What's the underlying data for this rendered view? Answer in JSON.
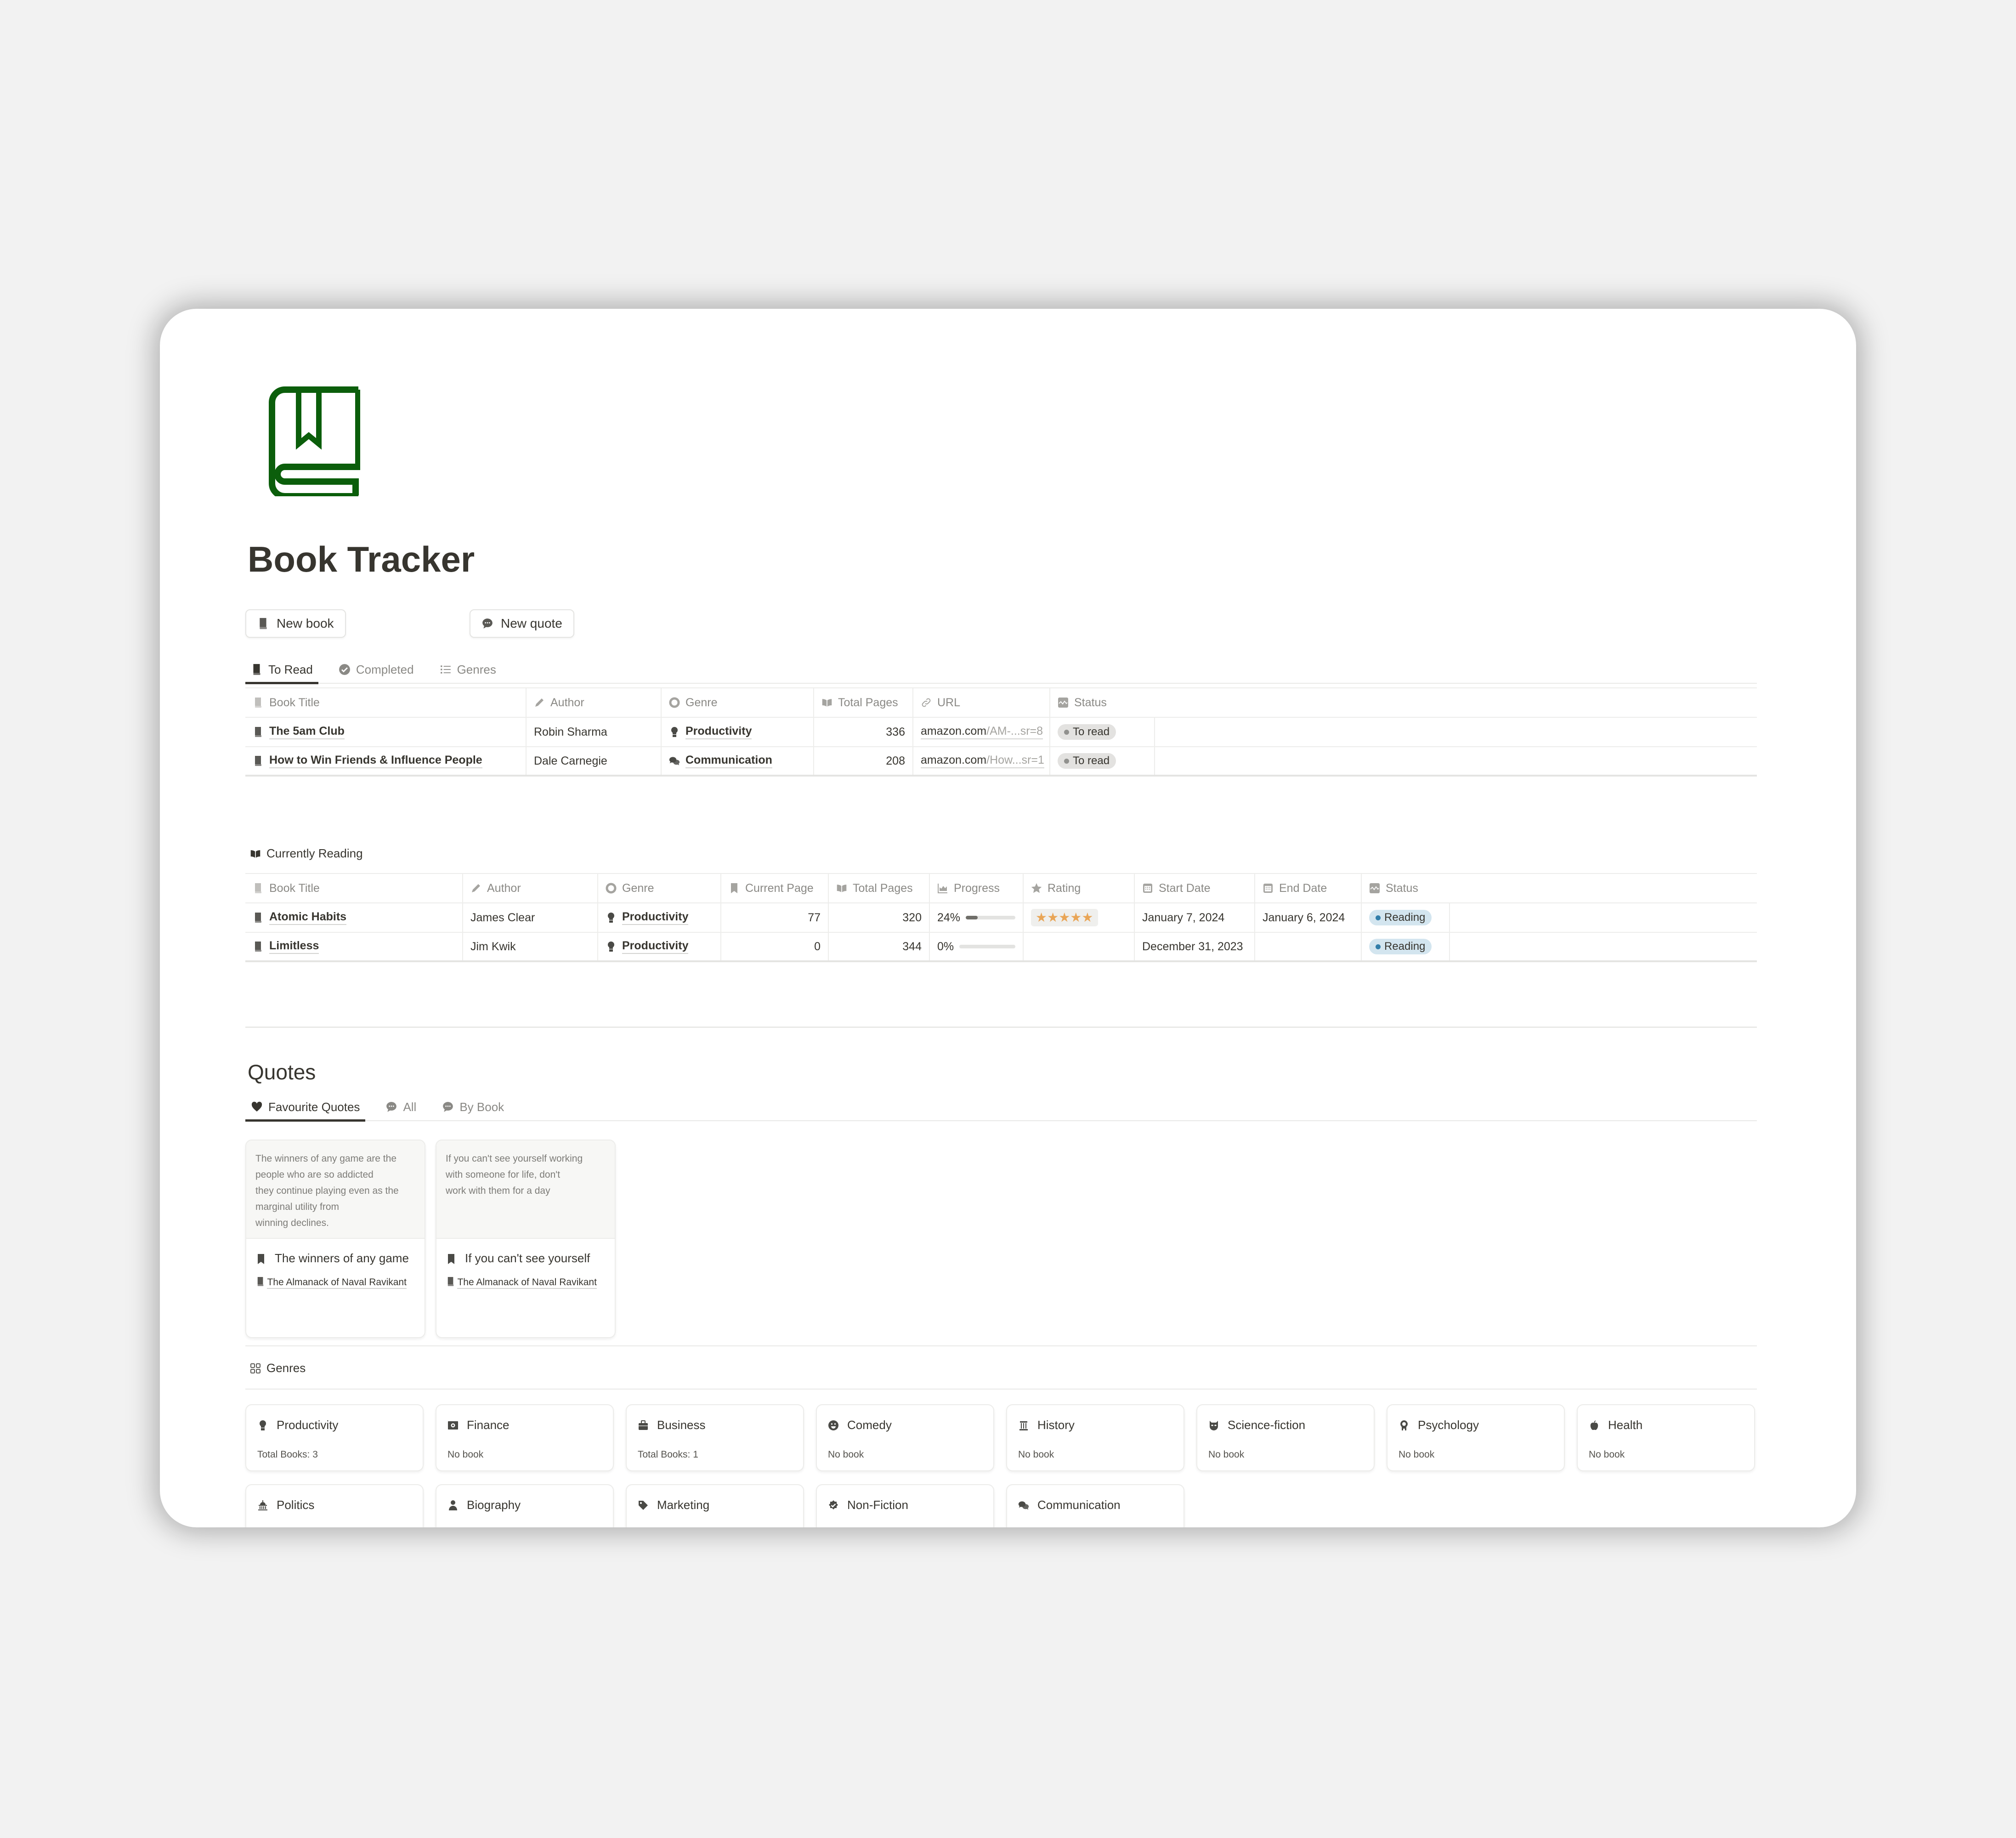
{
  "page": {
    "title": "Book Tracker",
    "icon": "book-bookmark-icon",
    "icon_color": "#0b5e0b"
  },
  "buttons": {
    "new_book": "New book",
    "new_quote": "New quote"
  },
  "to_read": {
    "tabs": [
      {
        "label": "To Read",
        "icon": "book-icon",
        "active": true
      },
      {
        "label": "Completed",
        "icon": "check-circle-icon",
        "active": false
      },
      {
        "label": "Genres",
        "icon": "list-icon",
        "active": false
      }
    ],
    "columns": [
      "Book Title",
      "Author",
      "Genre",
      "Total Pages",
      "URL",
      "Status"
    ],
    "rows": [
      {
        "title": "The 5am Club",
        "author": "Robin Sharma",
        "genre": "Productivity",
        "genre_icon": "lightbulb-head-icon",
        "total_pages": "336",
        "url_domain": "amazon.com",
        "url_path": "/AM-...sr=8",
        "status": "To read"
      },
      {
        "title": "How to Win Friends & Influence People",
        "author": "Dale Carnegie",
        "genre": "Communication",
        "genre_icon": "chat-bubbles-icon",
        "total_pages": "208",
        "url_domain": "amazon.com",
        "url_path": "/How...sr=1",
        "status": "To read"
      }
    ],
    "status_color": "#e3e2e0",
    "status_dot": "#91918e"
  },
  "currently_reading": {
    "label": "Currently Reading",
    "columns": [
      "Book Title",
      "Author",
      "Genre",
      "Current Page",
      "Total Pages",
      "Progress",
      "Rating",
      "Start Date",
      "End Date",
      "Status"
    ],
    "rows": [
      {
        "title": "Atomic Habits",
        "author": "James Clear",
        "genre": "Productivity",
        "current_page": "77",
        "total_pages": "320",
        "progress_label": "24%",
        "progress": 0.24,
        "rating": "★★★★★",
        "rating_value": 5,
        "start_date": "January 7, 2024",
        "end_date": "January 6, 2024",
        "status": "Reading"
      },
      {
        "title": "Limitless",
        "author": "Jim Kwik",
        "genre": "Productivity",
        "current_page": "0",
        "total_pages": "344",
        "progress_label": "0%",
        "progress": 0,
        "rating": "",
        "rating_value": 0,
        "start_date": "December 31, 2023",
        "end_date": "",
        "status": "Reading"
      }
    ],
    "status_color": "#d3e5ef",
    "status_dot": "#337ea9",
    "star_color": "#e9a556"
  },
  "quotes": {
    "heading": "Quotes",
    "tabs": [
      {
        "label": "Favourite Quotes",
        "icon": "heart-icon",
        "active": true
      },
      {
        "label": "All",
        "icon": "speech-bubble-icon",
        "active": false
      },
      {
        "label": "By Book",
        "icon": "speech-bubble-icon",
        "active": false
      }
    ],
    "cards": [
      {
        "preview": "The winners of any game are the\npeople who are so addicted\nthey continue playing even as the\nmarginal utility from\nwinning declines.",
        "title": "The winners of any game",
        "book": "The Almanack of Naval Ravikant"
      },
      {
        "preview": "If you can't see yourself working\nwith someone for life, don't\nwork with them for a day",
        "title": "If you can't see yourself",
        "book": "The Almanack of Naval Ravikant"
      }
    ]
  },
  "genres": {
    "label": "Genres",
    "cards": [
      {
        "name": "Productivity",
        "icon": "lightbulb-head-icon",
        "count": "Total Books: 3"
      },
      {
        "name": "Finance",
        "icon": "money-icon",
        "count": "No book"
      },
      {
        "name": "Business",
        "icon": "briefcase-icon",
        "count": "Total Books: 1"
      },
      {
        "name": "Comedy",
        "icon": "smiley-icon",
        "count": "No book"
      },
      {
        "name": "History",
        "icon": "column-icon",
        "count": "No book"
      },
      {
        "name": "Science-fiction",
        "icon": "alien-icon",
        "count": "No book"
      },
      {
        "name": "Psychology",
        "icon": "brain-head-icon",
        "count": "No book"
      },
      {
        "name": "Health",
        "icon": "apple-icon",
        "count": "No book"
      },
      {
        "name": "Politics",
        "icon": "capitol-icon",
        "count": ""
      },
      {
        "name": "Biography",
        "icon": "person-icon",
        "count": ""
      },
      {
        "name": "Marketing",
        "icon": "tag-icon",
        "count": ""
      },
      {
        "name": "Non-Fiction",
        "icon": "check-badge-icon",
        "count": ""
      },
      {
        "name": "Communication",
        "icon": "chat-bubbles-icon",
        "count": ""
      }
    ]
  }
}
